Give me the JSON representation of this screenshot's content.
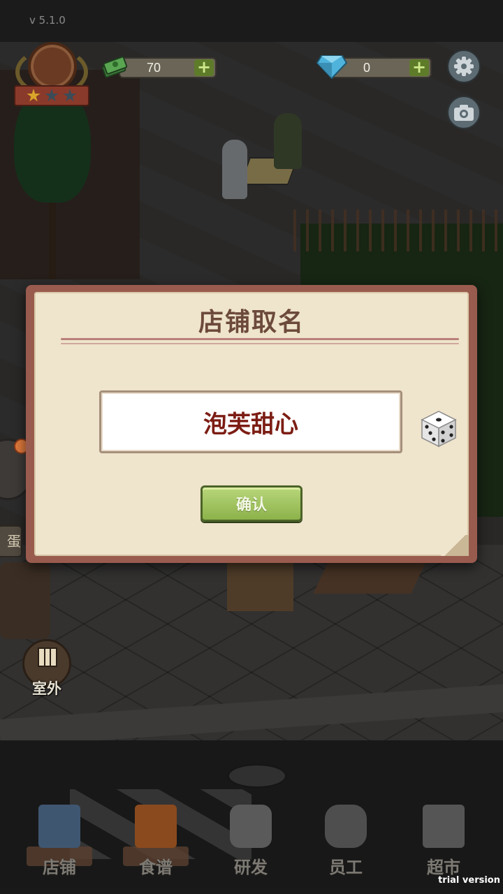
{
  "hud": {
    "version": "v 5.1.0",
    "cash_value": "70",
    "cash_plus": "+",
    "gem_value": "0",
    "gem_plus": "+"
  },
  "side": {
    "tag_label": "蛋糕",
    "outdoor_label": "室外"
  },
  "dialog": {
    "title": "店铺取名",
    "shop_name_value": "泡芙甜心",
    "confirm_label": "确认"
  },
  "nav": {
    "items": [
      {
        "label": "店铺"
      },
      {
        "label": "食谱"
      },
      {
        "label": "研发"
      },
      {
        "label": "员工"
      },
      {
        "label": "超市"
      }
    ]
  },
  "footer": {
    "watermark": "trial version"
  },
  "colors": {
    "dialog_frame": "#9a5b4f",
    "dialog_paper": "#efe4cc",
    "title_text": "#6c4a3b",
    "name_text": "#7c1d14",
    "confirm_button": "#a4c560"
  },
  "icons": {
    "cash": "cash-stack-icon",
    "gem": "diamond-icon",
    "settings": "gear-icon",
    "camera": "camera-icon",
    "dice": "dice-icon"
  }
}
